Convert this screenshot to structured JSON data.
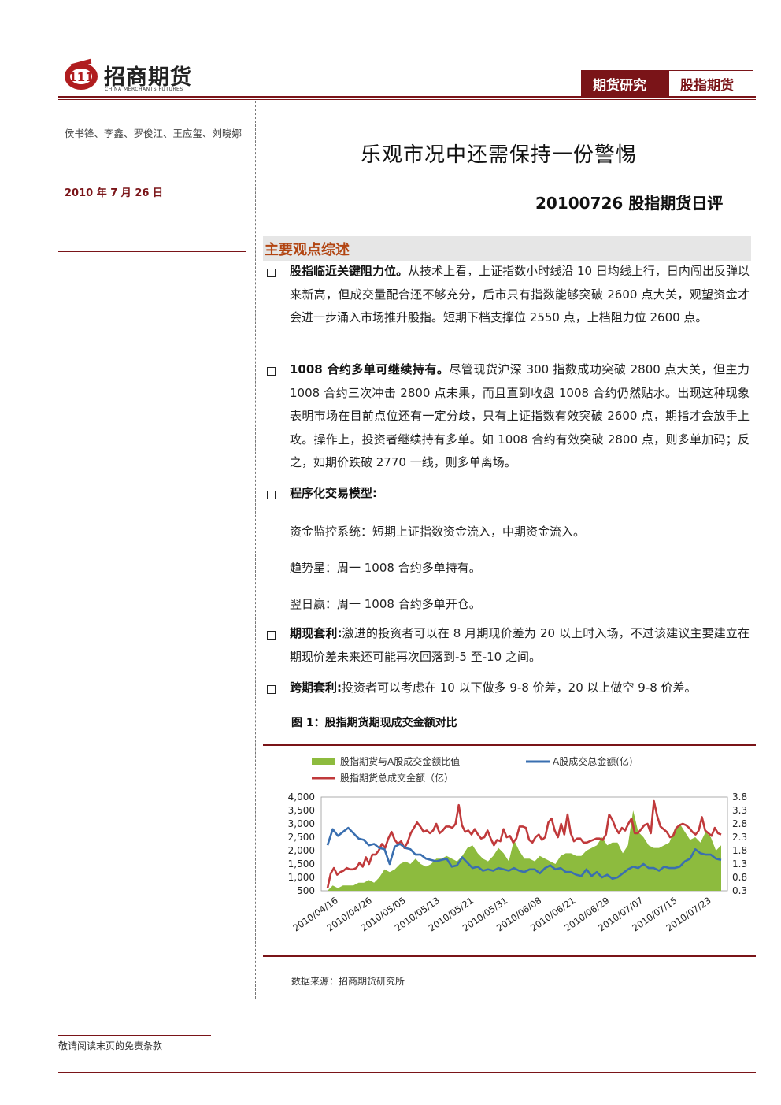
{
  "header": {
    "logo_text": "招商期货",
    "logo_en": "CHINA MERCHANTS FUTURES",
    "tag_primary": "期货研究",
    "tag_secondary": "股指期货"
  },
  "sidebar": {
    "authors": "侯书锋、李鑫、罗俊江、王应玺、刘晓娜",
    "date": "2010 年 7 月 26 日"
  },
  "title": "乐观市况中还需保持一份警惕",
  "subtitle": "20100726 股指期货日评",
  "section": {
    "heading": "主要观点综述"
  },
  "points": [
    {
      "bold": "股指临近关键阻力位。",
      "text": "从技术上看，上证指数小时线沿 10 日均线上行，日内闯出反弹以来新高，但成交量配合还不够充分，后市只有指数能够突破 2600 点大关，观望资金才会进一步涌入市场推升股指。短期下档支撑位 2550 点，上档阻力位 2600 点。"
    },
    {
      "bold": "1008 合约多单可继续持有。",
      "text": "尽管现货沪深 300 指数成功突破 2800 点大关，但主力 1008 合约三次冲击 2800 点未果，而且直到收盘 1008 合约仍然贴水。出现这种现象表明市场在目前点位还有一定分歧，只有上证指数有效突破 2600 点，期指才会放手上攻。操作上，投资者继续持有多单。如 1008 合约有效突破 2800 点，则多单加码；反之，如期价跌破 2770 一线，则多单离场。"
    },
    {
      "bold": "程序化交易模型:",
      "text": ""
    },
    {
      "bold": "期现套利:",
      "text": "激进的投资者可以在 8 月期现价差为 20 以上时入场，不过该建议主要建立在期现价差未来还可能再次回落到-5 至-10 之间。"
    },
    {
      "bold": "跨期套利:",
      "text": "投资者可以考虑在 10 以下做多 9-8 价差，20 以上做空 9-8 价差。"
    }
  ],
  "model_lines": [
    "资金监控系统：短期上证指数资金流入，中期资金流入。",
    "趋势星：周一 1008 合约多单持有。",
    "翌日赢：周一 1008 合约多单开仓。"
  ],
  "figure": {
    "title": "图 1：股指期货期现成交金额对比",
    "source": "数据来源：招商期货研究所"
  },
  "footer": {
    "disclaimer": "敬请阅读末页的免责条款"
  },
  "chart_data": {
    "type": "line",
    "legend": [
      "股指期货与A股成交金额比值",
      "A股成交总金额(亿)",
      "股指期货总成交金额（亿）"
    ],
    "categories": [
      "2010/04/16",
      "2010/04/26",
      "2010/05/05",
      "2010/05/13",
      "2010/05/21",
      "2010/05/31",
      "2010/06/08",
      "2010/06/21",
      "2010/06/29",
      "2010/07/07",
      "2010/07/15",
      "2010/07/23"
    ],
    "ylim_left": [
      500,
      4000
    ],
    "yticks_left": [
      "4,000",
      "3,500",
      "3,000",
      "2,500",
      "2,000",
      "1,500",
      "1,000",
      "500"
    ],
    "ylim_right": [
      0.3,
      3.8
    ],
    "yticks_right": [
      "3.8",
      "3.3",
      "2.8",
      "2.3",
      "1.8",
      "1.3",
      "0.8",
      "0.3"
    ],
    "colors": {
      "ratio": "#8dbb3e",
      "a_share": "#3a6fb0",
      "futures": "#c0393b"
    },
    "series": [
      {
        "name": "股指期货与A股成交金额比值",
        "axis": "right",
        "kind": "area",
        "values": [
          0.3,
          0.5,
          0.4,
          0.5,
          0.5,
          0.5,
          0.6,
          0.6,
          0.7,
          0.6,
          0.8,
          1.1,
          1.0,
          1.1,
          1.3,
          1.4,
          1.3,
          1.5,
          1.3,
          1.2,
          1.3,
          1.5,
          1.5,
          1.6,
          1.5,
          1.4,
          1.6,
          1.9,
          2.0,
          1.7,
          1.5,
          1.4,
          1.6,
          1.9,
          1.7,
          1.4,
          2.2,
          1.8,
          1.5,
          1.5,
          1.4,
          1.6,
          1.5,
          1.4,
          1.3,
          1.6,
          1.7,
          1.7,
          1.6,
          1.6,
          1.8,
          1.9,
          2.0,
          2.3,
          2.0,
          2.1,
          2.1,
          1.7,
          2.0,
          3.3,
          2.5,
          2.3,
          2.0,
          1.9,
          1.9,
          2.0,
          2.1,
          2.6,
          2.8,
          2.5,
          2.2,
          2.3,
          2.1,
          2.5,
          2.3,
          1.8,
          2.0
        ]
      },
      {
        "name": "A股成交总金额(亿)",
        "axis": "left",
        "kind": "line",
        "values": [
          2200,
          2800,
          2550,
          2700,
          2850,
          2650,
          2450,
          2400,
          2200,
          2250,
          2100,
          2050,
          1500,
          2150,
          2250,
          2100,
          2050,
          1850,
          1850,
          1700,
          1650,
          1600,
          1650,
          1700,
          1400,
          1450,
          1750,
          1550,
          1350,
          1400,
          1250,
          1300,
          1250,
          1350,
          1300,
          1250,
          1350,
          1250,
          1200,
          1300,
          1300,
          1150,
          1350,
          1450,
          1300,
          1350,
          1200,
          1200,
          1100,
          1050,
          1300,
          1050,
          1200,
          1000,
          1100,
          950,
          1000,
          1150,
          1300,
          1400,
          1350,
          1500,
          1350,
          1350,
          1250,
          1400,
          1350,
          1350,
          1400,
          1600,
          1700,
          2050,
          1900,
          1850,
          1850,
          1700,
          1650
        ]
      },
      {
        "name": "股指期货总成交金额（亿）",
        "axis": "left",
        "kind": "line",
        "values": [
          600,
          1150,
          1350,
          1100,
          1200,
          1250,
          1350,
          1300,
          1300,
          1350,
          1550,
          1400,
          1750,
          1500,
          1850,
          1850,
          2000,
          2250,
          2100,
          2450,
          2700,
          2400,
          2250,
          2350,
          2100,
          2300,
          2650,
          2850,
          3050,
          2900,
          2700,
          2750,
          2650,
          2750,
          3000,
          2650,
          2750,
          2900,
          2900,
          2850,
          3000,
          3700,
          2950,
          2700,
          2750,
          2600,
          2800,
          2600,
          2450,
          2500,
          2750,
          2450,
          2200,
          2400,
          2350,
          2800,
          2500,
          2550,
          2300,
          2450,
          2900,
          2900,
          2850,
          2400,
          2300,
          2500,
          2600,
          2400,
          2500,
          3050,
          3200,
          2750,
          2500,
          3000,
          2600,
          3350,
          2650,
          2350,
          2450,
          2450,
          2300,
          2300,
          2350,
          2400,
          2450,
          2450,
          2400,
          2600,
          3350,
          3150,
          2850,
          2650,
          2850,
          2750,
          3000,
          3200,
          2650,
          2650,
          2800,
          2950,
          3000,
          2650,
          3850,
          3300,
          2900,
          2800,
          2700,
          2500,
          2550,
          2850,
          2950,
          3000,
          2950,
          2850,
          2700,
          2600,
          2750,
          3250,
          2750,
          2650,
          2550,
          2850,
          2650,
          2600
        ]
      }
    ]
  }
}
